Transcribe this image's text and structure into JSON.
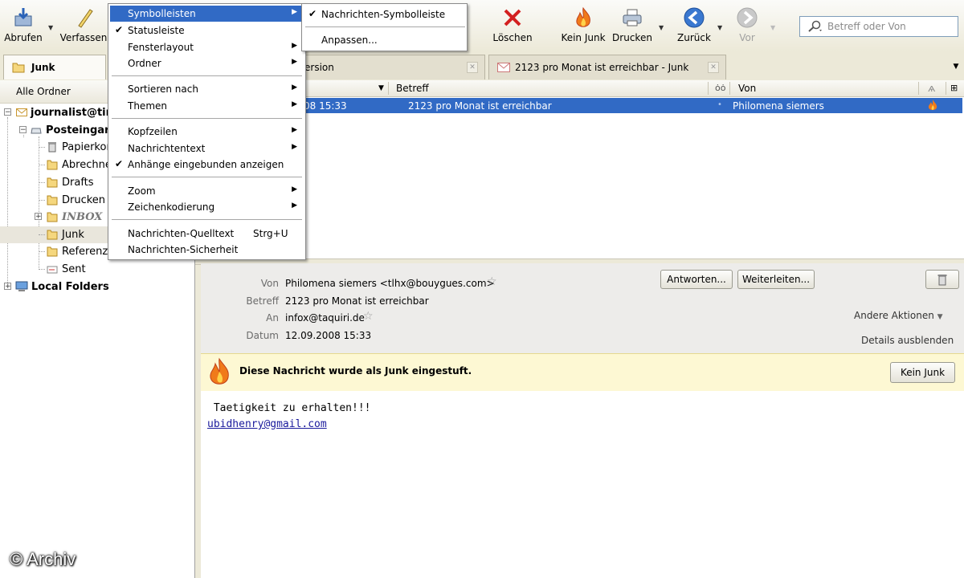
{
  "toolbar": {
    "buttons": {
      "abrufen": "Abrufen",
      "verfassen": "Verfassen",
      "loeschen": "Löschen",
      "kein_junk": "Kein Junk",
      "drucken": "Drucken",
      "zurueck": "Zurück",
      "vor": "Vor"
    },
    "search_placeholder": "Betreff oder Von"
  },
  "tabs": [
    {
      "label": "Junk",
      "active": true
    },
    {
      "label": "ersion",
      "active": false
    },
    {
      "label": "2123 pro Monat ist erreichbar - Junk",
      "active": false
    }
  ],
  "folder_pane": {
    "header": "Alle Ordner",
    "folders": {
      "account": "journalist@tir",
      "posteingang": "Posteingar",
      "papierkorb": "Papierkor",
      "abrechnung": "Abrechne",
      "drafts": "Drafts",
      "drucken": "Drucken",
      "inbox": "INBOX",
      "junk": "Junk",
      "referenz": "Referenz",
      "sent": "Sent",
      "local": "Local Folders"
    }
  },
  "message_list": {
    "columns": {
      "betreff": "Betreff",
      "von": "Von"
    },
    "rows": [
      {
        "date": "08 15:33",
        "subject": "2123 pro Monat ist erreichbar",
        "from": "Philomena siemers",
        "junk": true,
        "selected": true
      }
    ]
  },
  "message_header": {
    "labels": {
      "von": "Von",
      "betreff": "Betreff",
      "an": "An",
      "datum": "Datum"
    },
    "from": "Philomena siemers  <tlhx@bouygues.com>",
    "subject": "2123 pro Monat ist erreichbar",
    "to": "infox@taquiri.de",
    "date": "12.09.2008 15:33",
    "buttons": {
      "antworten": "Antworten...",
      "weiterleiten": "Weiterleiten..."
    },
    "andere_aktionen": "Andere Aktionen",
    "details_ausblenden": "Details ausblenden"
  },
  "junk_bar": {
    "message": "Diese Nachricht wurde als Junk eingestuft.",
    "button": "Kein Junk"
  },
  "body": {
    "line1": " Taetigkeit zu erhalten!!!",
    "link": "ubidhenry@gmail.com"
  },
  "view_menu": {
    "items": {
      "symbolleisten": "Symbolleisten",
      "statusleiste": "Statusleiste",
      "fensterlayout": "Fensterlayout",
      "ordner": "Ordner",
      "sortieren": "Sortieren nach",
      "themen": "Themen",
      "kopfzeilen": "Kopfzeilen",
      "nachrichtentext": "Nachrichtentext",
      "anhaenge": "Anhänge eingebunden anzeigen",
      "zoom": "Zoom",
      "zeichenkodierung": "Zeichenkodierung",
      "quelltext": "Nachrichten-Quelltext",
      "quelltext_shortcut": "Strg+U",
      "sicherheit": "Nachrichten-Sicherheit"
    }
  },
  "submenu": {
    "items": {
      "nachrichten_symbolleiste": "Nachrichten-Symbolleiste",
      "anpassen": "Anpassen..."
    }
  },
  "watermark": "© Archiv",
  "colors": {
    "selection": "#316ac5",
    "junk_bar_bg": "#fdf8d3",
    "link": "#1a1a9c"
  }
}
